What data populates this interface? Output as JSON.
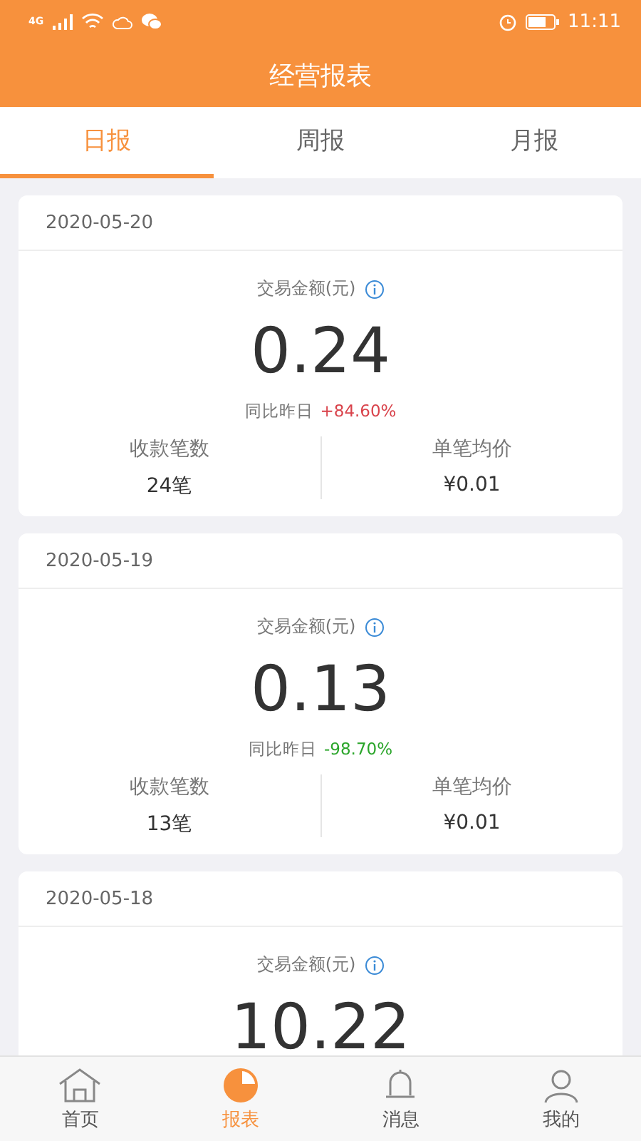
{
  "status_bar": {
    "time": "11:11",
    "network": "4G"
  },
  "title": "经营报表",
  "tabs": [
    {
      "label": "日报",
      "selected": true
    },
    {
      "label": "周报",
      "selected": false
    },
    {
      "label": "月报",
      "selected": false
    }
  ],
  "reports": [
    {
      "date": "2020-05-20",
      "amount_label": "交易金额(元)",
      "amount": "0.24",
      "compare_label": "同比昨日",
      "change": "+84.60%",
      "color": "#d9434b",
      "stats": [
        {
          "label": "收款笔数",
          "value": "24笔"
        },
        {
          "label": "单笔均价",
          "value": "¥0.01"
        }
      ]
    },
    {
      "date": "2020-05-19",
      "amount_label": "交易金额(元)",
      "amount": "0.13",
      "compare_label": "同比昨日",
      "change": "-98.70%",
      "color": "#2aa52a",
      "stats": [
        {
          "label": "收款笔数",
          "value": "13笔"
        },
        {
          "label": "单笔均价",
          "value": "¥0.01"
        }
      ]
    },
    {
      "date": "2020-05-18",
      "amount_label": "交易金额(元)",
      "amount": "10.22"
    }
  ],
  "nav": [
    {
      "label": "首页",
      "kind": "home",
      "selected": false
    },
    {
      "label": "报表",
      "kind": "chart",
      "selected": true
    },
    {
      "label": "消息",
      "kind": "bell",
      "selected": false
    },
    {
      "label": "我的",
      "kind": "user",
      "selected": false
    }
  ]
}
